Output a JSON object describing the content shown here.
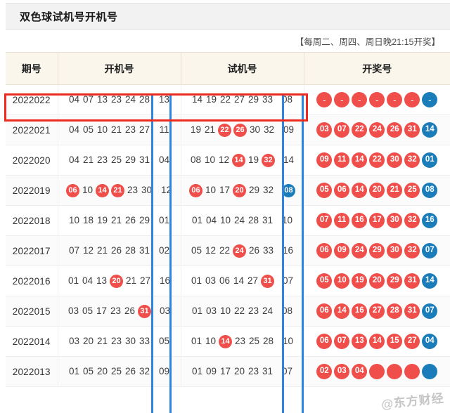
{
  "page": {
    "title": "双色球试机号开机号",
    "note": "【每周二、周四、周日晚21:15开奖】",
    "watermark": "@东方财经"
  },
  "colors": {
    "red_ball": "#ef4e4a",
    "blue_ball": "#1b7cba",
    "highlight_row": "#ee2a1e",
    "highlight_column": "#2a86e0",
    "header_bg": "#faf6ec",
    "titlebar_bg": "#f2f2f2"
  },
  "table": {
    "columns": [
      {
        "key": "issue",
        "label": "期号"
      },
      {
        "key": "open",
        "label": "开机号"
      },
      {
        "key": "test",
        "label": "试机号"
      },
      {
        "key": "draw",
        "label": "开奖号"
      }
    ],
    "rows": [
      {
        "issue": "2022022",
        "open": [
          {
            "n": "04",
            "s": "plain"
          },
          {
            "n": "07",
            "s": "plain"
          },
          {
            "n": "13",
            "s": "plain"
          },
          {
            "n": "23",
            "s": "plain"
          },
          {
            "n": "24",
            "s": "plain"
          },
          {
            "n": "28",
            "s": "plain"
          },
          {
            "n": "13",
            "s": "plain",
            "special": true
          }
        ],
        "test": [
          {
            "n": "14",
            "s": "plain"
          },
          {
            "n": "19",
            "s": "plain"
          },
          {
            "n": "22",
            "s": "plain"
          },
          {
            "n": "27",
            "s": "plain"
          },
          {
            "n": "29",
            "s": "plain"
          },
          {
            "n": "33",
            "s": "plain"
          },
          {
            "n": "08",
            "s": "plain",
            "special": true
          }
        ],
        "draw": [
          {
            "n": "-",
            "s": "red"
          },
          {
            "n": "-",
            "s": "red"
          },
          {
            "n": "-",
            "s": "red"
          },
          {
            "n": "-",
            "s": "red"
          },
          {
            "n": "-",
            "s": "red"
          },
          {
            "n": "-",
            "s": "red"
          },
          {
            "n": "-",
            "s": "blue"
          }
        ]
      },
      {
        "issue": "2022021",
        "open": [
          {
            "n": "04",
            "s": "plain"
          },
          {
            "n": "05",
            "s": "plain"
          },
          {
            "n": "10",
            "s": "plain"
          },
          {
            "n": "21",
            "s": "plain"
          },
          {
            "n": "23",
            "s": "plain"
          },
          {
            "n": "27",
            "s": "plain"
          },
          {
            "n": "11",
            "s": "plain",
            "special": true
          }
        ],
        "test": [
          {
            "n": "19",
            "s": "plain"
          },
          {
            "n": "21",
            "s": "plain"
          },
          {
            "n": "22",
            "s": "red"
          },
          {
            "n": "26",
            "s": "red"
          },
          {
            "n": "30",
            "s": "plain"
          },
          {
            "n": "32",
            "s": "plain"
          },
          {
            "n": "09",
            "s": "plain",
            "special": true
          }
        ],
        "draw": [
          {
            "n": "03",
            "s": "red"
          },
          {
            "n": "07",
            "s": "red"
          },
          {
            "n": "22",
            "s": "red"
          },
          {
            "n": "24",
            "s": "red"
          },
          {
            "n": "26",
            "s": "red"
          },
          {
            "n": "31",
            "s": "red"
          },
          {
            "n": "14",
            "s": "blue"
          }
        ]
      },
      {
        "issue": "2022020",
        "open": [
          {
            "n": "04",
            "s": "plain"
          },
          {
            "n": "21",
            "s": "plain"
          },
          {
            "n": "23",
            "s": "plain"
          },
          {
            "n": "25",
            "s": "plain"
          },
          {
            "n": "29",
            "s": "plain"
          },
          {
            "n": "31",
            "s": "plain"
          },
          {
            "n": "04",
            "s": "plain",
            "special": true
          }
        ],
        "test": [
          {
            "n": "08",
            "s": "plain"
          },
          {
            "n": "10",
            "s": "plain"
          },
          {
            "n": "12",
            "s": "plain"
          },
          {
            "n": "14",
            "s": "red"
          },
          {
            "n": "19",
            "s": "plain"
          },
          {
            "n": "32",
            "s": "red"
          },
          {
            "n": "14",
            "s": "plain",
            "special": true
          }
        ],
        "draw": [
          {
            "n": "09",
            "s": "red"
          },
          {
            "n": "11",
            "s": "red"
          },
          {
            "n": "14",
            "s": "red"
          },
          {
            "n": "22",
            "s": "red"
          },
          {
            "n": "30",
            "s": "red"
          },
          {
            "n": "32",
            "s": "red"
          },
          {
            "n": "01",
            "s": "blue"
          }
        ]
      },
      {
        "issue": "2022019",
        "open": [
          {
            "n": "06",
            "s": "red"
          },
          {
            "n": "10",
            "s": "plain"
          },
          {
            "n": "14",
            "s": "red"
          },
          {
            "n": "21",
            "s": "red"
          },
          {
            "n": "23",
            "s": "plain"
          },
          {
            "n": "30",
            "s": "plain"
          },
          {
            "n": "12",
            "s": "plain",
            "special": true
          }
        ],
        "test": [
          {
            "n": "06",
            "s": "red"
          },
          {
            "n": "10",
            "s": "plain"
          },
          {
            "n": "17",
            "s": "plain"
          },
          {
            "n": "20",
            "s": "red"
          },
          {
            "n": "29",
            "s": "plain"
          },
          {
            "n": "32",
            "s": "plain"
          },
          {
            "n": "08",
            "s": "blue",
            "special": true
          }
        ],
        "draw": [
          {
            "n": "05",
            "s": "red"
          },
          {
            "n": "06",
            "s": "red"
          },
          {
            "n": "14",
            "s": "red"
          },
          {
            "n": "20",
            "s": "red"
          },
          {
            "n": "21",
            "s": "red"
          },
          {
            "n": "25",
            "s": "red"
          },
          {
            "n": "08",
            "s": "blue"
          }
        ]
      },
      {
        "issue": "2022018",
        "open": [
          {
            "n": "10",
            "s": "plain"
          },
          {
            "n": "18",
            "s": "plain"
          },
          {
            "n": "19",
            "s": "plain"
          },
          {
            "n": "21",
            "s": "plain"
          },
          {
            "n": "26",
            "s": "plain"
          },
          {
            "n": "29",
            "s": "plain"
          },
          {
            "n": "01",
            "s": "plain",
            "special": true
          }
        ],
        "test": [
          {
            "n": "01",
            "s": "plain"
          },
          {
            "n": "04",
            "s": "plain"
          },
          {
            "n": "10",
            "s": "plain"
          },
          {
            "n": "24",
            "s": "plain"
          },
          {
            "n": "28",
            "s": "plain"
          },
          {
            "n": "31",
            "s": "plain"
          },
          {
            "n": "10",
            "s": "plain",
            "special": true
          }
        ],
        "draw": [
          {
            "n": "07",
            "s": "red"
          },
          {
            "n": "11",
            "s": "red"
          },
          {
            "n": "16",
            "s": "red"
          },
          {
            "n": "17",
            "s": "red"
          },
          {
            "n": "30",
            "s": "red"
          },
          {
            "n": "32",
            "s": "red"
          },
          {
            "n": "16",
            "s": "blue"
          }
        ]
      },
      {
        "issue": "2022017",
        "open": [
          {
            "n": "07",
            "s": "plain"
          },
          {
            "n": "12",
            "s": "plain"
          },
          {
            "n": "21",
            "s": "plain"
          },
          {
            "n": "26",
            "s": "plain"
          },
          {
            "n": "28",
            "s": "plain"
          },
          {
            "n": "31",
            "s": "plain"
          },
          {
            "n": "02",
            "s": "plain",
            "special": true
          }
        ],
        "test": [
          {
            "n": "05",
            "s": "plain"
          },
          {
            "n": "12",
            "s": "plain"
          },
          {
            "n": "22",
            "s": "plain"
          },
          {
            "n": "24",
            "s": "red"
          },
          {
            "n": "26",
            "s": "plain"
          },
          {
            "n": "33",
            "s": "plain"
          },
          {
            "n": "16",
            "s": "plain",
            "special": true
          }
        ],
        "draw": [
          {
            "n": "06",
            "s": "red"
          },
          {
            "n": "09",
            "s": "red"
          },
          {
            "n": "24",
            "s": "red"
          },
          {
            "n": "29",
            "s": "red"
          },
          {
            "n": "30",
            "s": "red"
          },
          {
            "n": "32",
            "s": "red"
          },
          {
            "n": "07",
            "s": "blue"
          }
        ]
      },
      {
        "issue": "2022016",
        "open": [
          {
            "n": "01",
            "s": "plain"
          },
          {
            "n": "04",
            "s": "plain"
          },
          {
            "n": "13",
            "s": "plain"
          },
          {
            "n": "20",
            "s": "red"
          },
          {
            "n": "21",
            "s": "plain"
          },
          {
            "n": "27",
            "s": "plain"
          },
          {
            "n": "16",
            "s": "plain",
            "special": true
          }
        ],
        "test": [
          {
            "n": "01",
            "s": "plain"
          },
          {
            "n": "03",
            "s": "plain"
          },
          {
            "n": "06",
            "s": "plain"
          },
          {
            "n": "14",
            "s": "plain"
          },
          {
            "n": "27",
            "s": "plain"
          },
          {
            "n": "31",
            "s": "red"
          },
          {
            "n": "07",
            "s": "plain",
            "special": true
          }
        ],
        "draw": [
          {
            "n": "05",
            "s": "red"
          },
          {
            "n": "10",
            "s": "red"
          },
          {
            "n": "19",
            "s": "red"
          },
          {
            "n": "20",
            "s": "red"
          },
          {
            "n": "29",
            "s": "red"
          },
          {
            "n": "31",
            "s": "red"
          },
          {
            "n": "14",
            "s": "blue"
          }
        ]
      },
      {
        "issue": "2022015",
        "open": [
          {
            "n": "03",
            "s": "plain"
          },
          {
            "n": "05",
            "s": "plain"
          },
          {
            "n": "17",
            "s": "plain"
          },
          {
            "n": "23",
            "s": "plain"
          },
          {
            "n": "26",
            "s": "plain"
          },
          {
            "n": "31",
            "s": "red"
          },
          {
            "n": "03",
            "s": "plain",
            "special": true
          }
        ],
        "test": [
          {
            "n": "01",
            "s": "plain"
          },
          {
            "n": "03",
            "s": "plain"
          },
          {
            "n": "10",
            "s": "plain"
          },
          {
            "n": "22",
            "s": "plain"
          },
          {
            "n": "23",
            "s": "plain"
          },
          {
            "n": "24",
            "s": "plain"
          },
          {
            "n": "08",
            "s": "plain",
            "special": true
          }
        ],
        "draw": [
          {
            "n": "06",
            "s": "red"
          },
          {
            "n": "14",
            "s": "red"
          },
          {
            "n": "16",
            "s": "red"
          },
          {
            "n": "27",
            "s": "red"
          },
          {
            "n": "28",
            "s": "red"
          },
          {
            "n": "31",
            "s": "red"
          },
          {
            "n": "07",
            "s": "blue"
          }
        ]
      },
      {
        "issue": "2022014",
        "open": [
          {
            "n": "03",
            "s": "plain"
          },
          {
            "n": "20",
            "s": "plain"
          },
          {
            "n": "21",
            "s": "plain"
          },
          {
            "n": "23",
            "s": "plain"
          },
          {
            "n": "30",
            "s": "plain"
          },
          {
            "n": "33",
            "s": "plain"
          },
          {
            "n": "05",
            "s": "plain",
            "special": true
          }
        ],
        "test": [
          {
            "n": "01",
            "s": "plain"
          },
          {
            "n": "10",
            "s": "plain"
          },
          {
            "n": "14",
            "s": "red"
          },
          {
            "n": "23",
            "s": "plain"
          },
          {
            "n": "25",
            "s": "plain"
          },
          {
            "n": "28",
            "s": "plain"
          },
          {
            "n": "10",
            "s": "plain",
            "special": true
          }
        ],
        "draw": [
          {
            "n": "06",
            "s": "red"
          },
          {
            "n": "07",
            "s": "red"
          },
          {
            "n": "13",
            "s": "red"
          },
          {
            "n": "14",
            "s": "red"
          },
          {
            "n": "15",
            "s": "red"
          },
          {
            "n": "27",
            "s": "red"
          },
          {
            "n": "04",
            "s": "blue"
          }
        ]
      },
      {
        "issue": "2022013",
        "open": [
          {
            "n": "01",
            "s": "plain"
          },
          {
            "n": "05",
            "s": "plain"
          },
          {
            "n": "20",
            "s": "plain"
          },
          {
            "n": "25",
            "s": "plain"
          },
          {
            "n": "26",
            "s": "plain"
          },
          {
            "n": "32",
            "s": "plain"
          },
          {
            "n": "09",
            "s": "plain",
            "special": true
          }
        ],
        "test": [
          {
            "n": "01",
            "s": "plain"
          },
          {
            "n": "09",
            "s": "plain"
          },
          {
            "n": "17",
            "s": "plain"
          },
          {
            "n": "20",
            "s": "plain"
          },
          {
            "n": "23",
            "s": "plain"
          },
          {
            "n": "31",
            "s": "plain"
          },
          {
            "n": "07",
            "s": "plain",
            "special": true
          }
        ],
        "draw": [
          {
            "n": "02",
            "s": "red"
          },
          {
            "n": "03",
            "s": "red"
          },
          {
            "n": "04",
            "s": "red"
          },
          {
            "n": "",
            "s": "red"
          },
          {
            "n": "",
            "s": "red"
          },
          {
            "n": "",
            "s": "red"
          },
          {
            "n": "",
            "s": "blue"
          }
        ]
      }
    ]
  },
  "annotations": {
    "row_highlight_issue": "2022022",
    "column_highlights": [
      "开机号-蓝球",
      "试机号-蓝球"
    ]
  }
}
